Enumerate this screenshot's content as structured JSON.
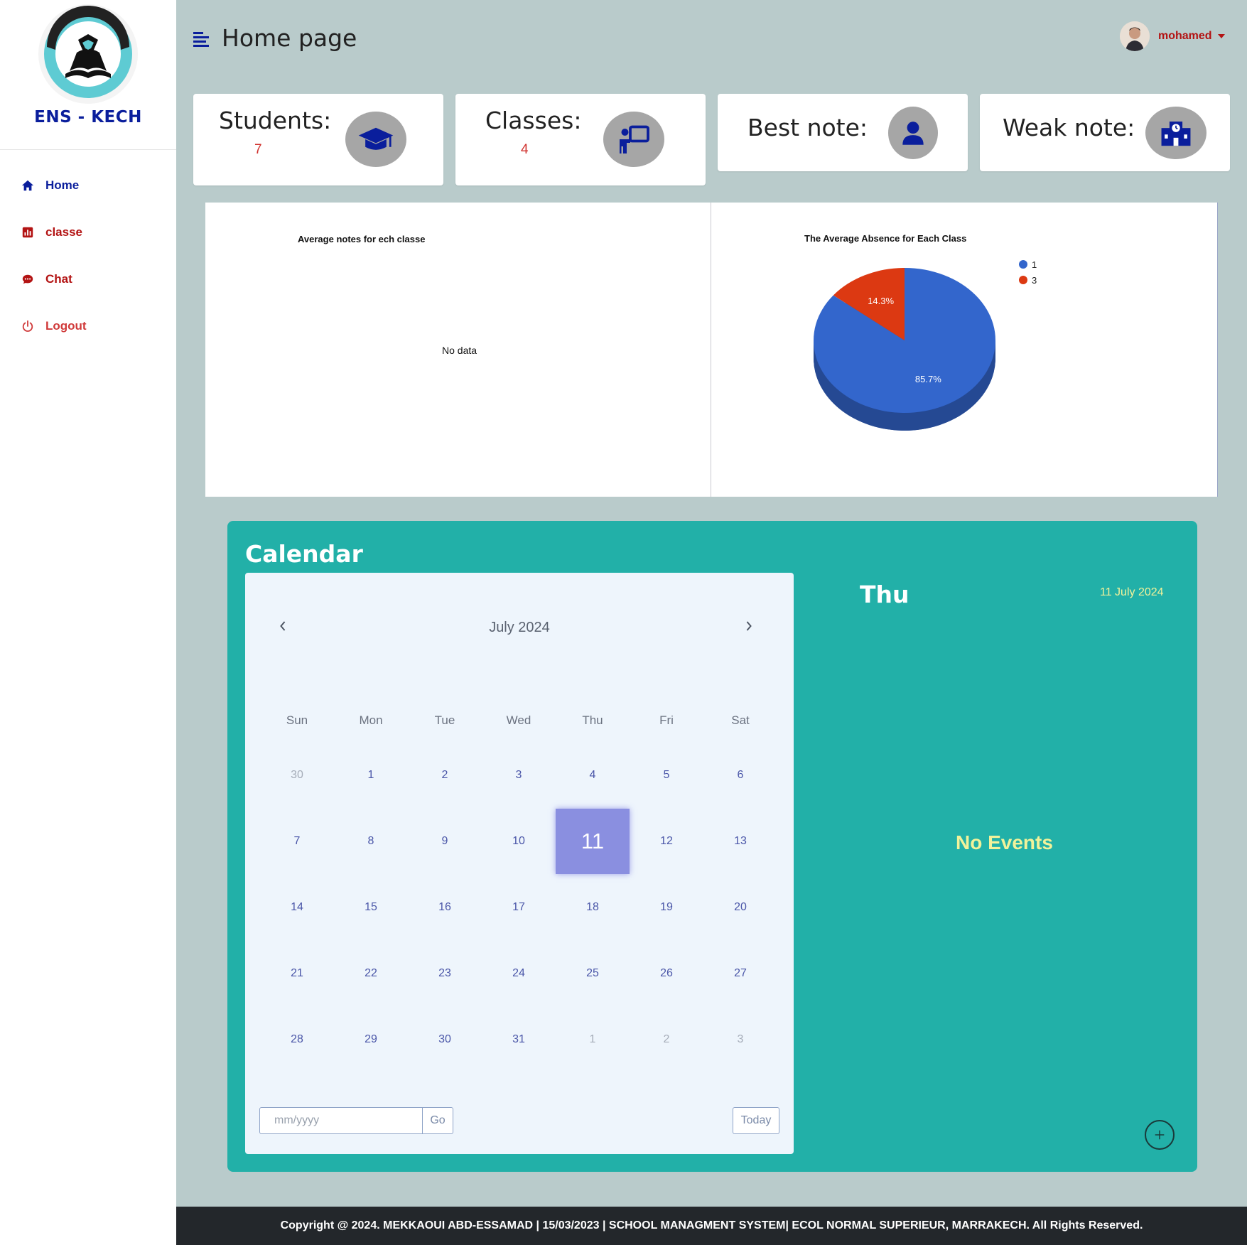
{
  "brand": {
    "name": "ENS - KECH"
  },
  "sidebar": {
    "items": [
      {
        "label": "Home",
        "icon": "home-icon",
        "color": "#0a1e9c"
      },
      {
        "label": "classe",
        "icon": "chart-icon",
        "color": "#b31313"
      },
      {
        "label": "Chat",
        "icon": "chat-icon",
        "color": "#b31313"
      },
      {
        "label": "Logout",
        "icon": "power-icon",
        "color": "#b31313"
      }
    ]
  },
  "header": {
    "title": "Home page",
    "user_name": "mohamed"
  },
  "stats": {
    "students": {
      "label": "Students:",
      "value": "7",
      "icon": "graduation-cap-icon"
    },
    "classes": {
      "label": "Classes:",
      "value": "4",
      "icon": "teacher-board-icon"
    },
    "best": {
      "label": "Best note:",
      "icon": "user-icon"
    },
    "weak": {
      "label": "Weak note:",
      "icon": "school-icon"
    }
  },
  "chart_data": [
    {
      "type": "bar",
      "title": "Average notes for ech classe",
      "empty_text": "No data",
      "categories": [],
      "values": []
    },
    {
      "type": "pie",
      "title": "The Average Absence for Each Class",
      "legend_position": "top-right",
      "slices": [
        {
          "label": "1",
          "value": 85.7,
          "display": "85.7%",
          "color": "#3366cc"
        },
        {
          "label": "3",
          "value": 14.3,
          "display": "14.3%",
          "color": "#dc3912"
        }
      ]
    }
  ],
  "calendar": {
    "heading": "Calendar",
    "month_label": "July 2024",
    "weekdays": [
      "Sun",
      "Mon",
      "Tue",
      "Wed",
      "Thu",
      "Fri",
      "Sat"
    ],
    "weeks": [
      [
        "30",
        "1",
        "2",
        "3",
        "4",
        "5",
        "6"
      ],
      [
        "7",
        "8",
        "9",
        "10",
        "11",
        "12",
        "13"
      ],
      [
        "14",
        "15",
        "16",
        "17",
        "18",
        "19",
        "20"
      ],
      [
        "21",
        "22",
        "23",
        "24",
        "25",
        "26",
        "27"
      ],
      [
        "28",
        "29",
        "30",
        "31",
        "1",
        "2",
        "3"
      ]
    ],
    "muted_cells": [
      "0-0",
      "4-4",
      "4-5",
      "4-6"
    ],
    "selected_cell": "1-4",
    "input_placeholder": "mm/yyyy",
    "go_label": "Go",
    "today_label": "Today"
  },
  "events": {
    "day_name": "Thu",
    "date_label": "11 July 2024",
    "empty_label": "No Events"
  },
  "footer": {
    "text": "Copyright @ 2024. MEKKAOUI ABD-ESSAMAD | 15/03/2023 | SCHOOL MANAGMENT SYSTEM| ECOL NORMAL SUPERIEUR, MARRAKECH. All Rights Reserved."
  }
}
